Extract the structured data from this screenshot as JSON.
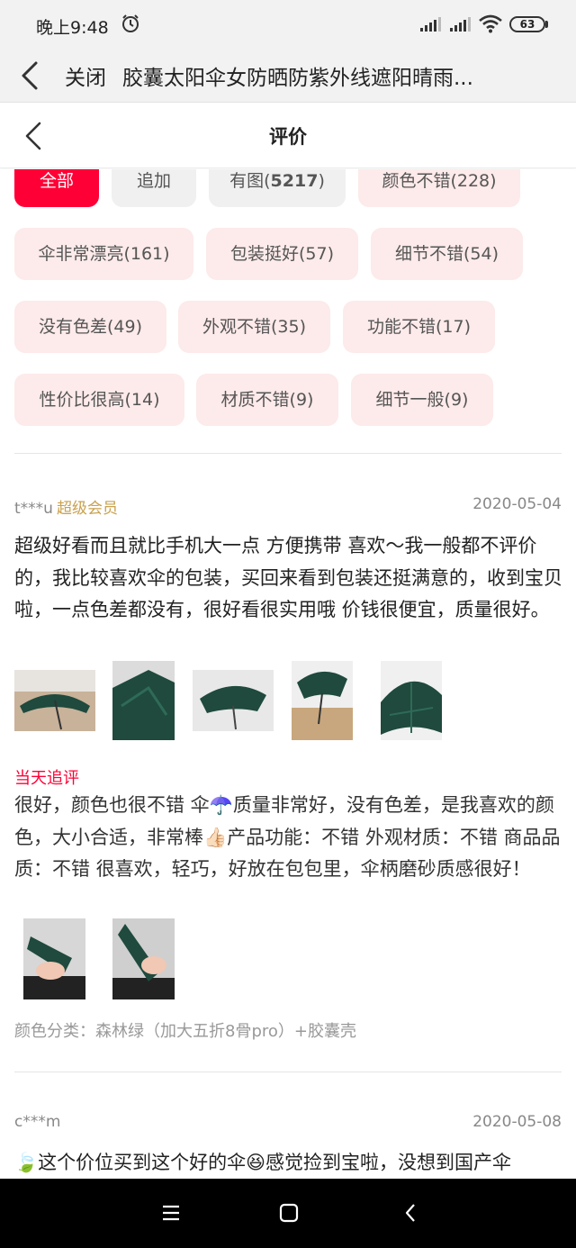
{
  "status_bar": {
    "time": "晚上9:48",
    "battery": "63",
    "icons": [
      "alarm-icon",
      "signal-icon",
      "signal-icon",
      "wifi-icon",
      "battery-icon"
    ]
  },
  "browser_bar": {
    "close_label": "关闭",
    "title": "胶囊太阳伞女防晒防紫外线遮阳晴雨..."
  },
  "page_header": {
    "title": "评价"
  },
  "tags": [
    {
      "label": "全部",
      "state": "active"
    },
    {
      "label": "追加",
      "state": "grey"
    },
    {
      "label": "有图(",
      "count": "5217",
      "suffix": ")",
      "state": "grey"
    },
    {
      "label": "颜色不错(228)",
      "state": "normal"
    },
    {
      "label": "伞非常漂亮(161)",
      "state": "normal"
    },
    {
      "label": "包装挺好(57)",
      "state": "normal"
    },
    {
      "label": "细节不错(54)",
      "state": "normal"
    },
    {
      "label": "没有色差(49)",
      "state": "normal"
    },
    {
      "label": "外观不错(35)",
      "state": "normal"
    },
    {
      "label": "功能不错(17)",
      "state": "normal"
    },
    {
      "label": "性价比很高(14)",
      "state": "normal"
    },
    {
      "label": "材质不错(9)",
      "state": "normal"
    },
    {
      "label": "细节一般(9)",
      "state": "normal"
    }
  ],
  "reviews": [
    {
      "user": "t***u",
      "badge": "超级会员",
      "date": "2020-05-04",
      "text": "超级好看而且就比手机大一点 方便携带 喜欢～我一般都不评价的，我比较喜欢伞的包装，买回来看到包装还挺满意的，收到宝贝啦，一点色差都没有，很好看很实用哦 价钱很便宜，质量很好。",
      "photos": [
        "umbrella-photo-1",
        "umbrella-photo-2",
        "umbrella-photo-3",
        "umbrella-photo-4",
        "umbrella-photo-5"
      ],
      "followup_label": "当天追评",
      "followup_text": "很好，颜色也很不错 伞☂️质量非常好，没有色差，是我喜欢的颜色，大小合适，非常棒👍🏻产品功能：不错 外观材质：不错 商品品质：不错 很喜欢，轻巧，好放在包包里，伞柄磨砂质感很好！",
      "followup_photos": [
        "folded-umbrella-photo-1",
        "folded-umbrella-photo-2"
      ],
      "spec": "颜色分类：森林绿（加大五折8骨pro）+胶囊壳"
    },
    {
      "user": "c***m",
      "date": "2020-05-08",
      "text": "🍃这个价位买到这个好的伞😆感觉捡到宝啦，没想到国产伞"
    }
  ],
  "nav_bar": {
    "icons": [
      "menu-icon",
      "home-icon",
      "back-icon"
    ]
  },
  "colors": {
    "accent": "#ff0036",
    "tag_bg": "#fdeaea",
    "tag_grey_bg": "#f0f0f0",
    "member": "#c9a14d",
    "umbrella_green": "#1f4a3d"
  }
}
